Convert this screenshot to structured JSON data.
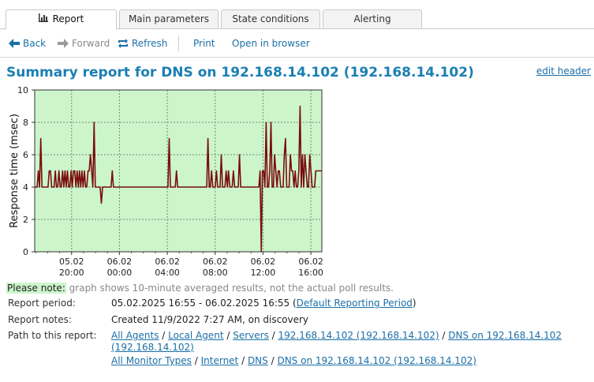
{
  "tabs": [
    {
      "label": "Report",
      "active": true,
      "icon": "bar-chart-icon"
    },
    {
      "label": "Main parameters",
      "active": false
    },
    {
      "label": "State conditions",
      "active": false
    },
    {
      "label": "Alerting",
      "active": false
    }
  ],
  "toolbar": {
    "back": "Back",
    "forward": "Forward",
    "refresh": "Refresh",
    "print": "Print",
    "open_in_browser": "Open in browser"
  },
  "title": "Summary report for DNS on 192.168.14.102 (192.168.14.102)",
  "edit_header": "edit header",
  "note": {
    "label": "Please note:",
    "text": " graph shows 10-minute averaged results, not the actual poll results."
  },
  "info": {
    "report_period_label": "Report period:",
    "report_period_value": "05.02.2025 16:55 - 06.02.2025 16:55 (",
    "report_period_link": "Default Reporting Period",
    "report_period_close": ")",
    "report_notes_label": "Report notes:",
    "report_notes_value": "Created 11/9/2022 7:27 AM, on discovery",
    "path_label": "Path to this report:",
    "path_line1": [
      "All Agents",
      "Local Agent",
      "Servers",
      "192.168.14.102 (192.168.14.102)",
      "DNS on 192.168.14.102 (192.168.14.102)"
    ],
    "path_line2": [
      "All Monitor Types",
      "Internet",
      "DNS",
      "DNS on 192.168.14.102 (192.168.14.102)"
    ],
    "path_separator": " / "
  },
  "colors": {
    "accent": "#1a7fb4",
    "link": "#1a6fa8",
    "plot_bg": "#ccf5cc",
    "series": "#7a0c0c"
  },
  "chart_data": {
    "type": "line",
    "ylabel": "Response time (msec)",
    "ylim": [
      0,
      10
    ],
    "yticks": [
      0,
      2,
      4,
      6,
      8,
      10
    ],
    "x_tick_labels": [
      [
        "05.02",
        "20:00"
      ],
      [
        "06.02",
        "00:00"
      ],
      [
        "06.02",
        "04:00"
      ],
      [
        "06.02",
        "08:00"
      ],
      [
        "06.02",
        "12:00"
      ],
      [
        "06.02",
        "16:00"
      ]
    ],
    "x_tick_hours": [
      3.083,
      7.083,
      11.083,
      15.083,
      19.083,
      23.083
    ],
    "x_range_hours": [
      0,
      24
    ],
    "grid": true,
    "series": [
      {
        "values": [
          4,
          4,
          4,
          5,
          4,
          7,
          4,
          4,
          4,
          4,
          4,
          4,
          5,
          5,
          4,
          4,
          4,
          5,
          4,
          4,
          5,
          4,
          4,
          5,
          4,
          5,
          4,
          5,
          4,
          4,
          5,
          4,
          5,
          5,
          4,
          5,
          4,
          5,
          4,
          5,
          4,
          5,
          4,
          4,
          5,
          5,
          6,
          5,
          4,
          8,
          4,
          4,
          4,
          4,
          4,
          3,
          4,
          4,
          4,
          4,
          4,
          4,
          4,
          4,
          5,
          4,
          4,
          4,
          4,
          4,
          4,
          4,
          4,
          4,
          4,
          4,
          4,
          4,
          4,
          4,
          4,
          4,
          4,
          4,
          4,
          4,
          4,
          4,
          4,
          4,
          4,
          4,
          4,
          4,
          4,
          4,
          4,
          4,
          4,
          4,
          4,
          4,
          4,
          4,
          4,
          4,
          4,
          4,
          4,
          4,
          4,
          7,
          4,
          4,
          4,
          4,
          4,
          5,
          4,
          4,
          4,
          4,
          4,
          4,
          4,
          4,
          4,
          4,
          4,
          4,
          4,
          4,
          4,
          4,
          4,
          4,
          4,
          4,
          4,
          4,
          4,
          4,
          4,
          7,
          4,
          4,
          5,
          4,
          4,
          4,
          5,
          4,
          4,
          4,
          6,
          4,
          4,
          4,
          5,
          4,
          5,
          4,
          4,
          4,
          5,
          4,
          4,
          4,
          4,
          6,
          4,
          4,
          4,
          4,
          4,
          4,
          4,
          4,
          4,
          4,
          4,
          4,
          4,
          4,
          4,
          4,
          5,
          0,
          5,
          5,
          4,
          8,
          4,
          4,
          5,
          8,
          4,
          4,
          6,
          5,
          4,
          5,
          5,
          4,
          4,
          4,
          6,
          7,
          4,
          4,
          4,
          6,
          5,
          5,
          4,
          5,
          4,
          4,
          5,
          9,
          4,
          6,
          4,
          6,
          5,
          4,
          4,
          6,
          5,
          4,
          4,
          4,
          5,
          5,
          5,
          5,
          5,
          5
        ]
      }
    ]
  }
}
